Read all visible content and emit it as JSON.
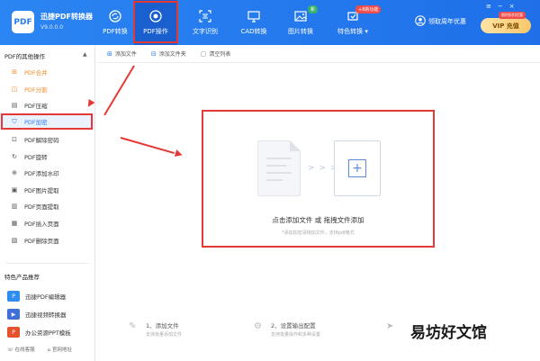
{
  "app": {
    "logo_text": "PDF",
    "name": "迅捷PDF转换器",
    "version": "V9.0.0.0"
  },
  "nav": [
    {
      "label": "PDF转换",
      "icon": "refresh-icon"
    },
    {
      "label": "PDF操作",
      "icon": "target-icon"
    },
    {
      "label": "文字识别",
      "icon": "scan-text-icon"
    },
    {
      "label": "CAD转换",
      "icon": "monitor-icon"
    },
    {
      "label": "图片转换",
      "icon": "image-icon"
    },
    {
      "label": "特色转换",
      "icon": "sparkle-icon"
    }
  ],
  "nav_badges": {
    "image": "新",
    "special": "+8新功能"
  },
  "user": {
    "label": "领取周年优惠"
  },
  "vip": {
    "label": "VIP",
    "sub": "充值",
    "tag": "限时折扣优惠"
  },
  "sidebar": {
    "header": "PDF的其他操作",
    "items": [
      {
        "label": "PDF合并",
        "icon": "merge-icon"
      },
      {
        "label": "PDF分割",
        "icon": "split-icon"
      },
      {
        "label": "PDF压缩",
        "icon": "compress-icon"
      },
      {
        "label": "PDF加密",
        "icon": "shield-icon"
      },
      {
        "label": "PDF解除密码",
        "icon": "lock-icon"
      },
      {
        "label": "PDF旋转",
        "icon": "rotate-icon"
      },
      {
        "label": "PDF添加水印",
        "icon": "watermark-icon"
      },
      {
        "label": "PDF图片提取",
        "icon": "picture-icon"
      },
      {
        "label": "PDF页面提取",
        "icon": "page-icon"
      },
      {
        "label": "PDF插入页面",
        "icon": "insert-icon"
      },
      {
        "label": "PDF删除页面",
        "icon": "delete-page-icon"
      }
    ],
    "features_header": "特色产品推荐",
    "features": [
      {
        "label": "迅捷PDF编辑器",
        "color": "#2f8cf0"
      },
      {
        "label": "迅捷视频转换器",
        "color": "#3f6fd8"
      },
      {
        "label": "办公资源PPT模板",
        "color": "#e5532d"
      }
    ],
    "bottom": [
      "在线客服",
      "官网地址"
    ]
  },
  "toolbar": {
    "add_file": "添加文件",
    "add_folder": "添加文件夹",
    "clear_list": "清空列表"
  },
  "dropzone": {
    "arrows": "> > >",
    "plus": "+",
    "title": "点击添加文件 或 拖拽文件添加",
    "subtitle": "*添加加密请拖加文件，支持pdf格式"
  },
  "steps": [
    {
      "title": "1、添加文件",
      "subtitle": "支持批量添加文件"
    },
    {
      "title": "2、设置输出配置",
      "subtitle": "支持批量操作和多种设置"
    }
  ],
  "watermark": "易坊好文馆"
}
